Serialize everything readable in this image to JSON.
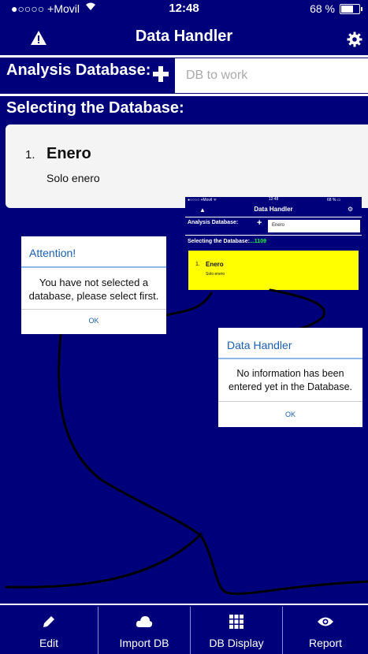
{
  "status_bar": {
    "carrier": "●○○○○ +Movil",
    "time": "12:48",
    "battery": "68 %"
  },
  "navbar": {
    "title": "Data Handler",
    "warning_icon": "warning-triangle-icon",
    "settings_icon": "gear-icon"
  },
  "analysis": {
    "label": "Analysis Database:",
    "add_icon": "plus-icon",
    "input_placeholder": "DB to work",
    "input_value": ""
  },
  "selecting": {
    "label": "Selecting the Database:"
  },
  "list": {
    "items": [
      {
        "number": "1.",
        "name": "Enero",
        "subtitle": "Solo enero"
      }
    ]
  },
  "inset_screenshot": {
    "status_carrier": "●○○○○ +Movil ᯤ",
    "status_time": "12:48",
    "status_battery": "68 % ▭",
    "title": "Data Handler",
    "analysis_label": "Analysis Database:",
    "input_value": "Enero",
    "selecting_label": "Selecting the Database:",
    "selecting_count": "...1109",
    "item_number": "1.",
    "item_name": "Enero",
    "item_subtitle": "Solo enero",
    "highlight_color": "#ffff00"
  },
  "dialog_attention": {
    "title": "Attention!",
    "message_line1": "You have not selected a",
    "message_line2": "database, please select first.",
    "ok_label": "OK"
  },
  "dialog_data_handler": {
    "title": "Data Handler",
    "message_line1": "No information has been",
    "message_line2": "entered yet in the Database.",
    "ok_label": "OK"
  },
  "tabbar": {
    "tabs": [
      {
        "label": "Edit",
        "icon": "pencil-icon"
      },
      {
        "label": "Import DB",
        "icon": "cloud-icon"
      },
      {
        "label": "DB Display",
        "icon": "grid-icon"
      },
      {
        "label": "Report",
        "icon": "eye-icon"
      }
    ]
  },
  "colors": {
    "background": "#00007a",
    "dialog_title": "#1a5fb4",
    "inset_count": "#1eff3c"
  }
}
